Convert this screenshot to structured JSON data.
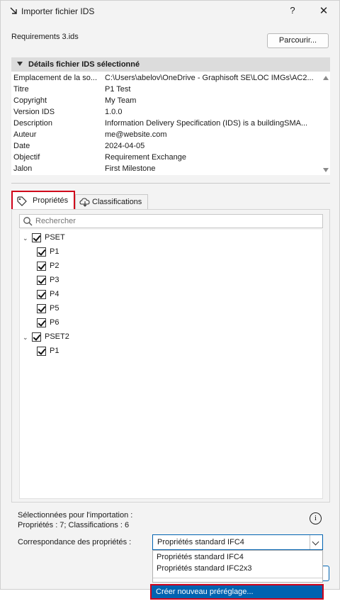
{
  "window": {
    "title": "Importer fichier IDS",
    "help_label": "?",
    "close_label": "✕"
  },
  "file": {
    "name": "Requirements 3.ids",
    "browse_label": "Parcourir..."
  },
  "details": {
    "header": "Détails fichier IDS sélectionné",
    "rows": [
      {
        "key": "Emplacement de la so...",
        "value": "C:\\Users\\abelov\\OneDrive - Graphisoft SE\\LOC IMGs\\AC2..."
      },
      {
        "key": "Titre",
        "value": "P1 Test"
      },
      {
        "key": "Copyright",
        "value": "My Team"
      },
      {
        "key": "Version IDS",
        "value": "1.0.0"
      },
      {
        "key": "Description",
        "value": "Information Delivery Specification (IDS) is a buildingSMA..."
      },
      {
        "key": "Auteur",
        "value": "me@website.com"
      },
      {
        "key": "Date",
        "value": "2024-04-05"
      },
      {
        "key": "Objectif",
        "value": "Requirement Exchange"
      },
      {
        "key": "Jalon",
        "value": "First Milestone"
      }
    ]
  },
  "tabs": {
    "properties": "Propriétés",
    "classifications": "Classifications"
  },
  "search": {
    "placeholder": "Rechercher"
  },
  "tree": {
    "groups": [
      {
        "label": "PSET",
        "checked": true,
        "items": [
          "P1",
          "P2",
          "P3",
          "P4",
          "P5",
          "P6"
        ]
      },
      {
        "label": "PSET2",
        "checked": true,
        "items": [
          "P1"
        ]
      }
    ]
  },
  "summary": {
    "selected_label": "Sélectionnées pour l'importation :",
    "counts": "Propriétés : 7; Classifications : 6",
    "info_glyph": "i"
  },
  "mapping": {
    "label": "Correspondance des propriétés :",
    "selected": "Propriétés standard IFC4",
    "options": [
      "Propriétés standard IFC4",
      "Propriétés standard IFC2x3"
    ],
    "create_label": "Créer nouveau préréglage..."
  },
  "colors": {
    "accent": "#0063b1",
    "highlight_border": "#d0021b",
    "header_bg": "#dcdcdc"
  }
}
